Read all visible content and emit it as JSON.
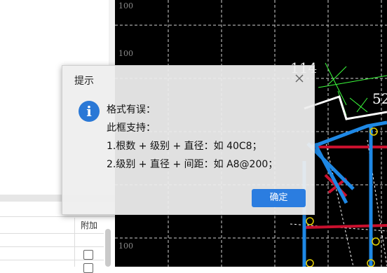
{
  "left_panel": {
    "table_header_label": "附加"
  },
  "cad_view": {
    "axis_labels": [
      "100",
      "100",
      "100"
    ],
    "annotation_a": "114",
    "annotation_b": "52"
  },
  "dialog": {
    "title": "提示",
    "icon": "info-icon",
    "message_lines": [
      "格式有误：",
      "此框支持：",
      "1.根数 + 级别 + 直径：如 40C8；",
      "2.级别 + 直径 + 间距：如 A8@200；"
    ],
    "ok_label": "确定"
  },
  "colors": {
    "accent": "#2b7de0",
    "cad_background": "#000000",
    "rebar_blue": "#1e88e5",
    "rebar_red": "#c8102e",
    "grid_green": "#3cff3c",
    "marker_yellow": "#e6d000"
  }
}
